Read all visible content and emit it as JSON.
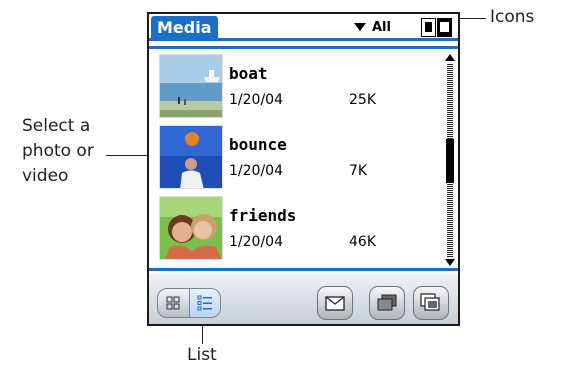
{
  "app": {
    "title": "Media",
    "category": "All"
  },
  "items": [
    {
      "name": "boat",
      "date": "1/20/04",
      "size": "25K"
    },
    {
      "name": "bounce",
      "date": "1/20/04",
      "size": "7K"
    },
    {
      "name": "friends",
      "date": "1/20/04",
      "size": "46K"
    }
  ],
  "callouts": {
    "icons": "Icons",
    "select_line1": "Select a",
    "select_line2": "photo or",
    "select_line3": "video",
    "list": "List"
  },
  "icons": {
    "view_toggle": [
      "single-view-icon",
      "dual-view-icon"
    ],
    "view_modes": [
      "thumbnail-view-icon",
      "list-view-icon"
    ],
    "toolbar": [
      "envelope-icon",
      "folder-icon",
      "slideshow-icon"
    ]
  },
  "colors": {
    "accent": "#1b6fc8",
    "toolbar_top": "#eef1f5",
    "toolbar_bottom": "#c9ced6"
  }
}
